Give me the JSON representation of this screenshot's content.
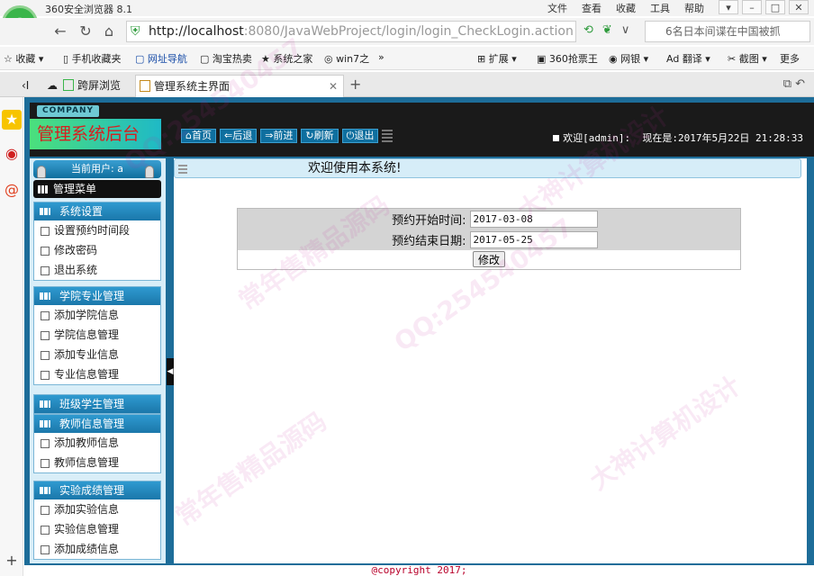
{
  "browser": {
    "app_title": "360安全浏览器 8.1",
    "menus": [
      "文件",
      "查看",
      "收藏",
      "工具",
      "帮助"
    ],
    "url_host": "http://localhost",
    "url_rest": ":8080/JavaWebProject/login/login_CheckLogin.action",
    "search_text": "6名日本间谍在中国被抓",
    "favorites": {
      "fav": "收藏",
      "mobile": "手机收藏夹",
      "nav": "网址导航",
      "taobao": "淘宝热卖",
      "xitong": "系统之家",
      "win7": "win7之",
      "more1": "»",
      "ext": "扩展",
      "ticket": "360抢票王",
      "bank": "网银",
      "translate": "翻译",
      "screenshot": "截图",
      "more": "更多"
    },
    "tabs": {
      "cross": "跨屏浏览",
      "main": "管理系统主界面"
    }
  },
  "header": {
    "company": "COMPANY",
    "brand": "管理系统后台",
    "nav": {
      "home": "首页",
      "back": "后退",
      "forward": "前进",
      "refresh": "刷新",
      "logout": "退出"
    },
    "welcome_prefix": "欢迎[admin]:",
    "now_label": "现在是:",
    "datetime": "2017年5月22日 21:28:33"
  },
  "sidebar": {
    "current_user": "当前用户: a",
    "menu_title": "管理菜单",
    "groups": [
      {
        "title": "系统设置",
        "items": [
          "设置预约时间段",
          "修改密码",
          "退出系统"
        ]
      },
      {
        "title": "学院专业管理",
        "items": [
          "添加学院信息",
          "学院信息管理",
          "添加专业信息",
          "专业信息管理"
        ]
      },
      {
        "title": "班级学生管理",
        "items": []
      },
      {
        "title": "教师信息管理",
        "items": [
          "添加教师信息",
          "教师信息管理"
        ]
      },
      {
        "title": "实验成绩管理",
        "items": [
          "添加实验信息",
          "实验信息管理",
          "添加成绩信息"
        ]
      }
    ]
  },
  "content": {
    "welcome": "欢迎使用本系统!",
    "form": {
      "start_label": "预约开始时间:",
      "start_value": "2017-03-08",
      "end_label": "预约结束日期:",
      "end_value": "2017-05-25",
      "submit": "修改"
    }
  },
  "footer": {
    "copyright": "@copyright 2017;"
  },
  "watermarks": [
    "QQ:254540457",
    "大神计算机设计",
    "常年售精品源码"
  ]
}
